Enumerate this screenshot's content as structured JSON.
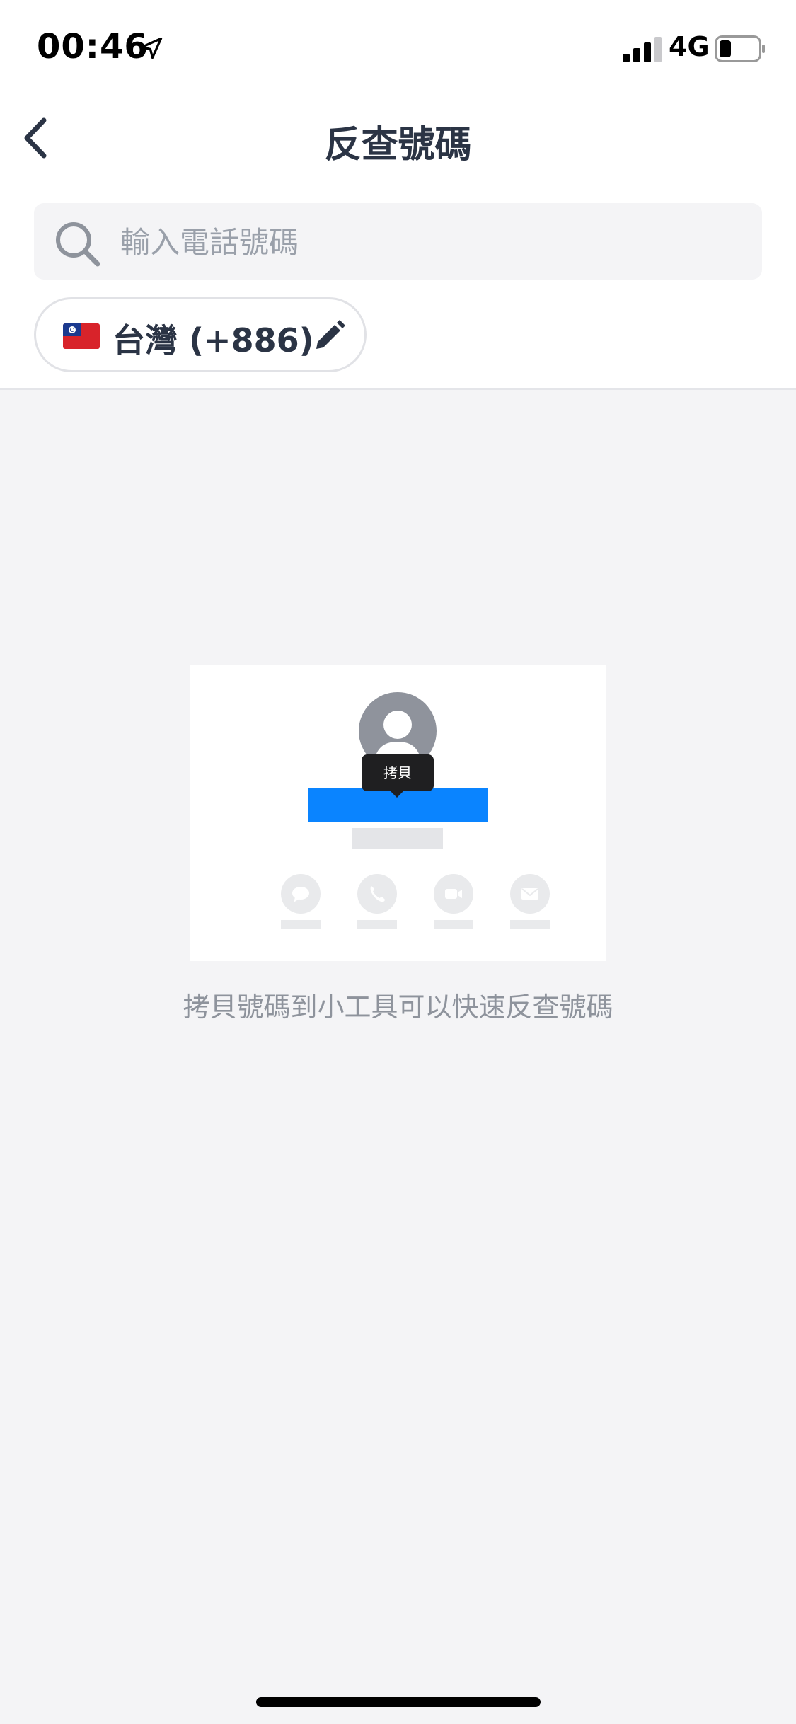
{
  "status_bar": {
    "time": "00:46",
    "network": "4G"
  },
  "nav": {
    "title": "反查號碼"
  },
  "search": {
    "placeholder": "輸入電話號碼",
    "value": ""
  },
  "country": {
    "label": "台灣 (+886)"
  },
  "illustration": {
    "tooltip_label": "拷貝"
  },
  "hint": "拷貝號碼到小工具可以快速反查號碼",
  "colors": {
    "accent": "#0a84ff",
    "text": "#2b3445",
    "muted": "#8e939c",
    "background": "#f4f4f6"
  }
}
